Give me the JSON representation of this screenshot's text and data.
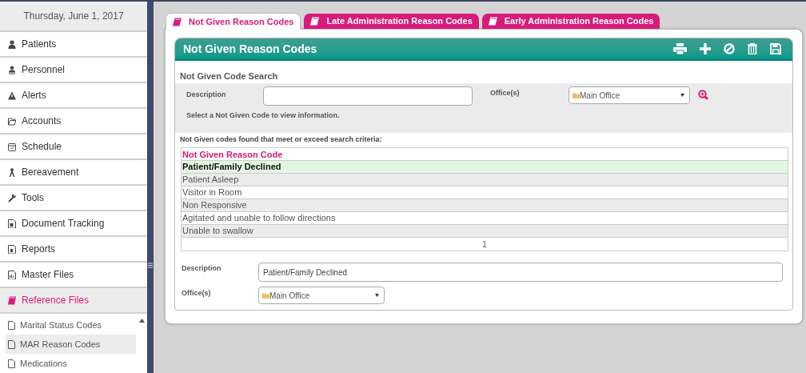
{
  "sidebar": {
    "date": "Thursday, June 1, 2017",
    "items": [
      {
        "label": "Patients",
        "selected": false
      },
      {
        "label": "Personnel",
        "selected": false
      },
      {
        "label": "Alerts",
        "selected": false
      },
      {
        "label": "Accounts",
        "selected": false
      },
      {
        "label": "Schedule",
        "selected": false
      },
      {
        "label": "Bereavement",
        "selected": false
      },
      {
        "label": "Tools",
        "selected": false
      },
      {
        "label": "Document Tracking",
        "selected": false
      },
      {
        "label": "Reports",
        "selected": false
      },
      {
        "label": "Master Files",
        "selected": false
      },
      {
        "label": "Reference Files",
        "selected": true
      }
    ],
    "subitems": [
      {
        "label": "Marital Status Codes",
        "selected": false
      },
      {
        "label": "MAR Reason Codes",
        "selected": true
      },
      {
        "label": "Medications",
        "selected": false
      }
    ]
  },
  "tabs": [
    {
      "label": "Not Given Reason Codes",
      "selected": true
    },
    {
      "label": "Late Administration Reason Codes",
      "selected": false
    },
    {
      "label": "Early Administration Reason Codes",
      "selected": false
    }
  ],
  "panel": {
    "title": "Not Given Reason Codes",
    "search": {
      "heading": "Not Given Code Search",
      "description_label": "Description",
      "office_label": "Office(s)",
      "office_value": "Main Office",
      "hint": "Select a Not Given Code to view information."
    },
    "results_caption": "Not Given codes found that meet or exceed search criteria:",
    "table": {
      "column": "Not Given Reason Code",
      "rows": [
        {
          "text": "Patient/Family Declined",
          "selected": true
        },
        {
          "text": "Patient Asleep",
          "selected": false
        },
        {
          "text": "Visitor in Room",
          "selected": false
        },
        {
          "text": "Non Responsive",
          "selected": false
        },
        {
          "text": "Agitated and unable to follow directions",
          "selected": false
        },
        {
          "text": "Unable to swallow",
          "selected": false
        }
      ],
      "page": "1"
    },
    "detail": {
      "description_label": "Description",
      "description_value": "Patient/Family Declined",
      "office_label": "Office(s)",
      "office_value": "Main Office"
    }
  }
}
